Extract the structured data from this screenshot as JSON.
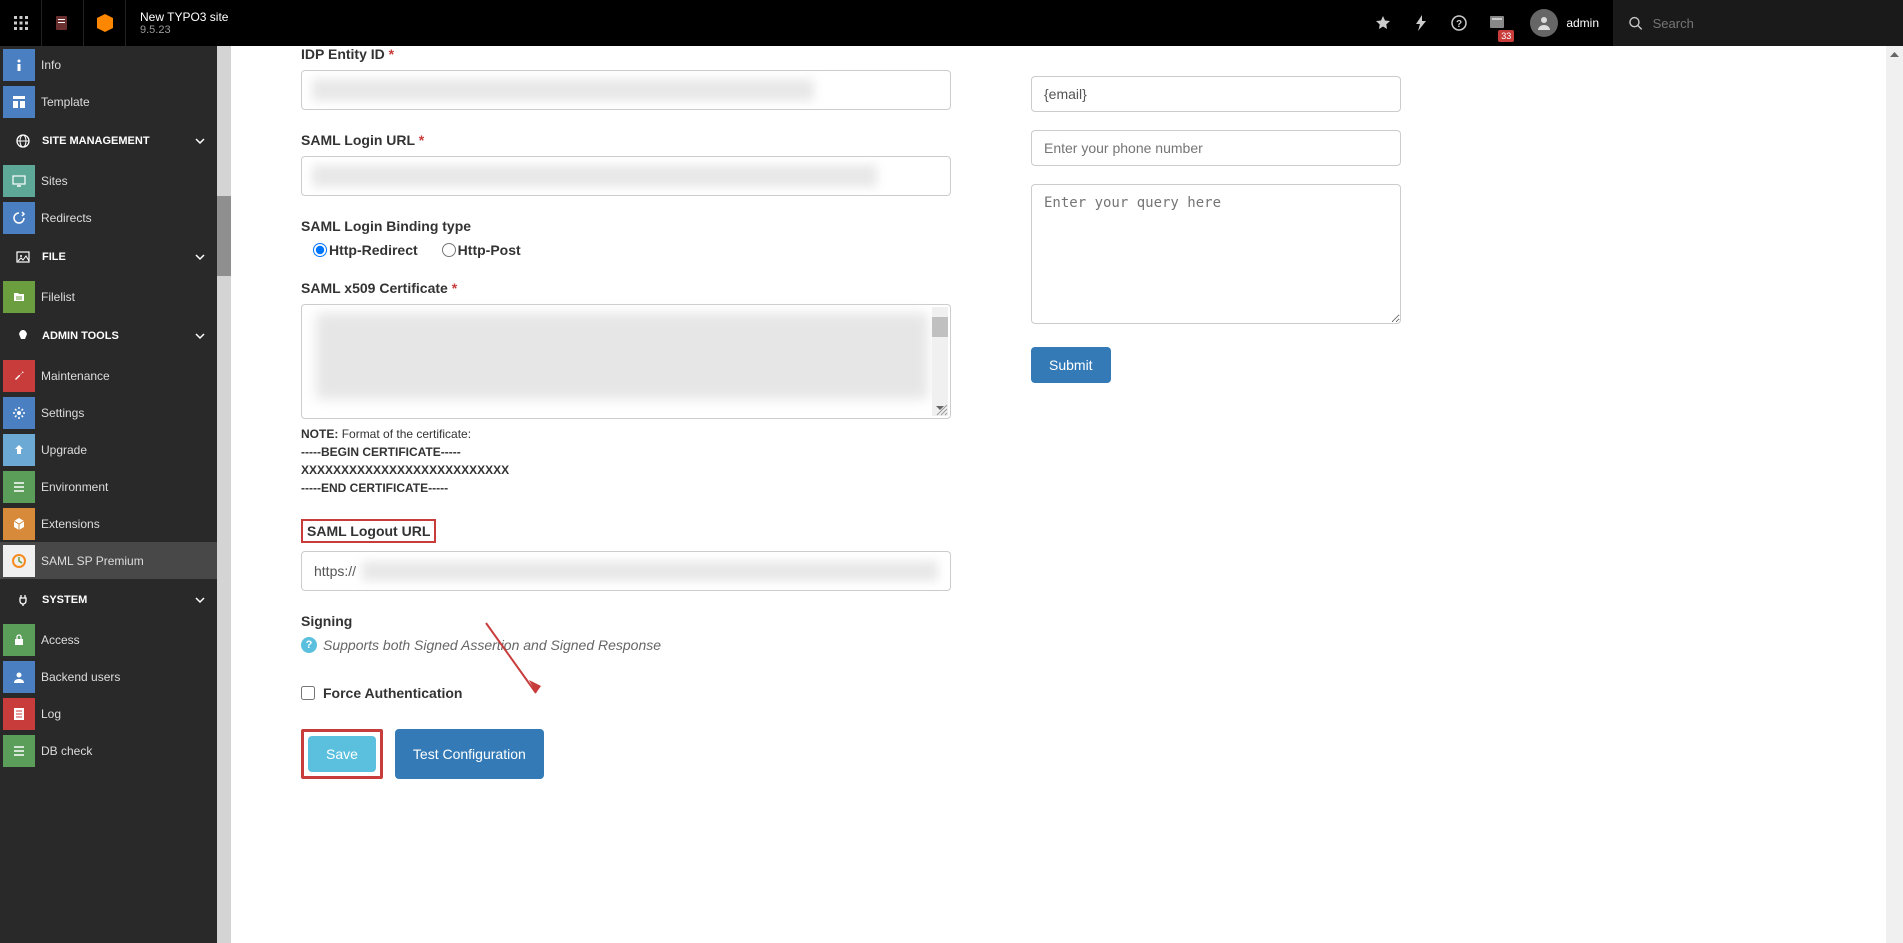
{
  "topbar": {
    "site_name": "New TYPO3 site",
    "version": "9.5.23",
    "badge": "33",
    "username": "admin",
    "search_placeholder": "Search"
  },
  "sidebar": {
    "items_top": [
      {
        "label": "Info",
        "color": "#4a7fc1"
      },
      {
        "label": "Template",
        "color": "#4a7fc1"
      }
    ],
    "site_mgmt": {
      "header": "SITE MANAGEMENT",
      "items": [
        {
          "label": "Sites",
          "color": "#5ea898"
        },
        {
          "label": "Redirects",
          "color": "#4a7fc1"
        }
      ]
    },
    "file": {
      "header": "FILE",
      "items": [
        {
          "label": "Filelist",
          "color": "#6a9e3e"
        }
      ]
    },
    "admin_tools": {
      "header": "ADMIN TOOLS",
      "items": [
        {
          "label": "Maintenance",
          "color": "#c83c3c"
        },
        {
          "label": "Settings",
          "color": "#4a7fc1"
        },
        {
          "label": "Upgrade",
          "color": "#6ca9d4"
        },
        {
          "label": "Environment",
          "color": "#5a9e5a"
        },
        {
          "label": "Extensions",
          "color": "#d68a3a"
        },
        {
          "label": "SAML SP Premium",
          "color": "#f0f0f0"
        }
      ]
    },
    "system": {
      "header": "SYSTEM",
      "items": [
        {
          "label": "Access",
          "color": "#5a9e5a"
        },
        {
          "label": "Backend users",
          "color": "#4a7fc1"
        },
        {
          "label": "Log",
          "color": "#c83c3c"
        },
        {
          "label": "DB check",
          "color": "#5a9e5a"
        }
      ]
    }
  },
  "form": {
    "idp_entity_label": "IDP Entity ID",
    "saml_login_url_label": "SAML Login URL",
    "binding_label": "SAML Login Binding type",
    "binding_http_redirect": "Http-Redirect",
    "binding_http_post": "Http-Post",
    "cert_label": "SAML x509 Certificate",
    "note_prefix": "NOTE:",
    "note_text": "Format of the certificate:",
    "cert_begin": "-----BEGIN CERTIFICATE-----",
    "cert_xxx": "XXXXXXXXXXXXXXXXXXXXXXXXXX",
    "cert_end": "-----END CERTIFICATE-----",
    "logout_url_label": "SAML Logout URL",
    "logout_url_prefix": "https://",
    "signing_label": "Signing",
    "signing_help": "Supports both Signed Assertion and Signed Response",
    "force_auth_label": "Force Authentication",
    "save_btn": "Save",
    "test_btn": "Test Configuration"
  },
  "contact": {
    "email_placeholder": "{email}",
    "phone_placeholder": "Enter your phone number",
    "query_placeholder": "Enter your query here",
    "submit": "Submit"
  }
}
